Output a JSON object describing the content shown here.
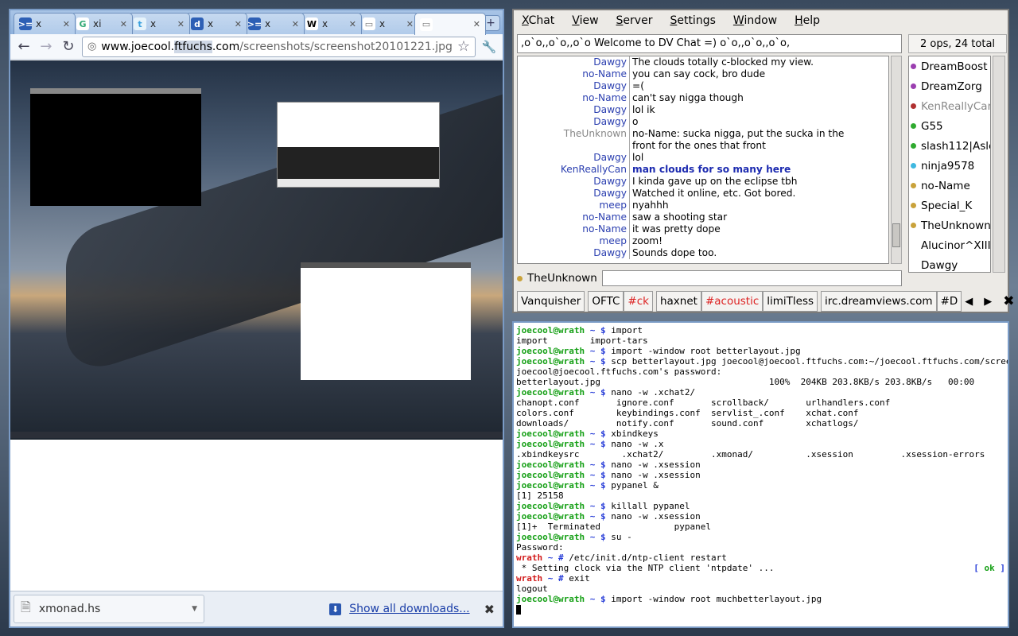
{
  "browser": {
    "tabs": [
      {
        "icon": "xmonad-icon",
        "title": "x"
      },
      {
        "icon": "google-icon",
        "title": "xi"
      },
      {
        "icon": "twitter-icon",
        "title": "x"
      },
      {
        "icon": "delicious-icon",
        "title": "x"
      },
      {
        "icon": "xmonad-icon",
        "title": "x"
      },
      {
        "icon": "wikipedia-icon",
        "title": "x"
      },
      {
        "icon": "page-icon",
        "title": "x"
      },
      {
        "icon": "page-icon",
        "title": ""
      }
    ],
    "url_host_pre": "www.joecool.",
    "url_host_hl": "ftfuchs",
    "url_host_post": ".com",
    "url_path": "/screenshots/screenshot20101221.jpg",
    "download_file": "xmonad.hs",
    "show_all_downloads": "Show all downloads..."
  },
  "xchat": {
    "menu": [
      "XChat",
      "View",
      "Server",
      "Settings",
      "Window",
      "Help"
    ],
    "topic": ",o`o,,o`o,,o`o Welcome to DV Chat =) o`o,,o`o,,o`o,",
    "ops_count": "2 ops, 24 total",
    "messages": [
      {
        "nick": "Dawgy",
        "text": "The clouds totally c-blocked my view."
      },
      {
        "nick": "no-Name",
        "text": "you can say cock, bro dude"
      },
      {
        "nick": "Dawgy",
        "text": "=("
      },
      {
        "nick": "no-Name",
        "text": "can't say nigga though"
      },
      {
        "nick": "Dawgy",
        "text": "lol ik"
      },
      {
        "nick": "Dawgy",
        "text": "o"
      },
      {
        "nick": "TheUnknown",
        "text": "no-Name: sucka nigga, put the sucka in the"
      },
      {
        "nick": "",
        "text": "front for the ones that front"
      },
      {
        "nick": "Dawgy",
        "text": "lol"
      },
      {
        "nick": "KenReallyCan",
        "text": "man clouds for so many here",
        "highlight": true
      },
      {
        "nick": "Dawgy",
        "text": "I kinda gave up on the eclipse tbh"
      },
      {
        "nick": "Dawgy",
        "text": "Watched it online, etc. Got bored."
      },
      {
        "nick": "meep",
        "text": "nyahhh"
      },
      {
        "nick": "no-Name",
        "text": "saw a shooting star"
      },
      {
        "nick": "no-Name",
        "text": "it was pretty dope"
      },
      {
        "nick": "meep",
        "text": "zoom!"
      },
      {
        "nick": "Dawgy",
        "text": "Sounds dope too."
      }
    ],
    "users": [
      {
        "name": "DreamBoost",
        "color": "#9b3fb0"
      },
      {
        "name": "DreamZorg",
        "color": "#9b3fb0"
      },
      {
        "name": "KenReallyCan",
        "color": "#b03030",
        "away": true
      },
      {
        "name": "G55",
        "color": "#2faa2f"
      },
      {
        "name": "slash112|Asleep",
        "color": "#2faa2f"
      },
      {
        "name": "ninja9578",
        "color": "#3fb8e0"
      },
      {
        "name": "no-Name",
        "color": "#c9a23a"
      },
      {
        "name": "Special_K",
        "color": "#c9a23a"
      },
      {
        "name": "TheUnknown",
        "color": "#c9a23a"
      },
      {
        "name": "Alucinor^XIII",
        "color": ""
      },
      {
        "name": "Dawgy",
        "color": ""
      }
    ],
    "own_nick": "TheUnknown",
    "channel_tabs": [
      {
        "label": "Vanquisher",
        "red": false
      },
      {
        "label": "OFTC",
        "red": false
      },
      {
        "label": "#ck",
        "red": true
      },
      {
        "label": "haxnet",
        "red": false
      },
      {
        "label": "#acoustic",
        "red": true
      },
      {
        "label": "limiTless",
        "red": false
      },
      {
        "label": "irc.dreamviews.com",
        "red": false
      },
      {
        "label": "#D",
        "red": false
      }
    ]
  },
  "terminal": {
    "lines": [
      {
        "t": "prompt",
        "cmd": "import"
      },
      {
        "t": "out",
        "text": "import        import-tars"
      },
      {
        "t": "prompt",
        "cmd": "import -window root betterlayout.jpg"
      },
      {
        "t": "prompt",
        "cmd": "scp betterlayout.jpg joecool@joecool.ftfuchs.com:~/joecool.ftfuchs.com/screenshots/"
      },
      {
        "t": "out",
        "text": "joecool@joecool.ftfuchs.com's password:"
      },
      {
        "t": "out",
        "text": "betterlayout.jpg                                100%  204KB 203.8KB/s 203.8KB/s   00:00"
      },
      {
        "t": "prompt",
        "cmd": "nano -w .xchat2/"
      },
      {
        "t": "out",
        "text": "chanopt.conf       ignore.conf       scrollback/       urlhandlers.conf"
      },
      {
        "t": "out",
        "text": "colors.conf        keybindings.conf  servlist_.conf    xchat.conf"
      },
      {
        "t": "out",
        "text": "downloads/         notify.conf       sound.conf        xchatlogs/"
      },
      {
        "t": "prompt",
        "cmd": "xbindkeys"
      },
      {
        "t": "prompt",
        "cmd": "nano -w .x"
      },
      {
        "t": "out",
        "text": ".xbindkeysrc        .xchat2/         .xmonad/          .xsession         .xsession-errors"
      },
      {
        "t": "prompt",
        "cmd": "nano -w .xsession"
      },
      {
        "t": "prompt",
        "cmd": "nano -w .xsession"
      },
      {
        "t": "prompt",
        "cmd": "pypanel &"
      },
      {
        "t": "out",
        "text": "[1] 25158"
      },
      {
        "t": "prompt",
        "cmd": "killall pypanel"
      },
      {
        "t": "prompt",
        "cmd": "nano -w .xsession"
      },
      {
        "t": "out",
        "text": "[1]+  Terminated              pypanel"
      },
      {
        "t": "prompt",
        "cmd": "su -"
      },
      {
        "t": "out",
        "text": "Password:"
      },
      {
        "t": "root",
        "cmd": "/etc/init.d/ntp-client restart"
      },
      {
        "t": "status",
        "text": " * Setting clock via the NTP client 'ntpdate' ...",
        "ok": "[ ok ]"
      },
      {
        "t": "root",
        "cmd": "exit"
      },
      {
        "t": "out",
        "text": "logout"
      },
      {
        "t": "prompt",
        "cmd": "import -window root muchbetterlayout.jpg"
      },
      {
        "t": "cursor"
      }
    ],
    "user_host": "joecool@wrath",
    "root_host": "wrath",
    "tilde": "~",
    "user_sigil": "$",
    "root_sigil": "#"
  }
}
